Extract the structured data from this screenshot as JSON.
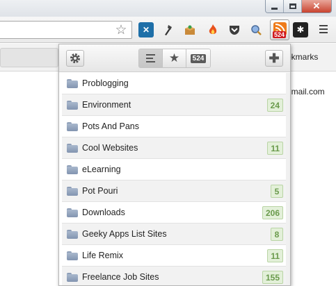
{
  "window": {
    "minimize_glyph": "min",
    "maximize_glyph": "max",
    "close_glyph": "✕"
  },
  "toolbar": {
    "bookmark_star": "☆",
    "extensions": [
      {
        "icon": "stack-icon",
        "glyph": "✕"
      },
      {
        "icon": "tool-icon",
        "glyph": "⚒"
      },
      {
        "icon": "box-icon",
        "glyph": "📦"
      },
      {
        "icon": "fire-icon",
        "glyph": "🔥"
      },
      {
        "icon": "pocket-icon",
        "glyph": "⛉"
      },
      {
        "icon": "search-icon",
        "glyph": "⚲"
      }
    ],
    "rss_badge": "524",
    "ext_dark_glyph": "✱"
  },
  "bookmarks_bar": {
    "right_label": "okmarks",
    "email_fragment": "gmail.com"
  },
  "popup": {
    "toolbar": {
      "settings_icon": "gear-icon",
      "list_tab_icon": "list-icon",
      "favorites_tab_glyph": "★",
      "count_tab": "524",
      "add_glyph": "✚"
    },
    "folders": [
      {
        "name": "Problogging",
        "count": ""
      },
      {
        "name": "Environment",
        "count": "24"
      },
      {
        "name": "Pots And Pans",
        "count": ""
      },
      {
        "name": "Cool Websites",
        "count": "11"
      },
      {
        "name": "eLearning",
        "count": ""
      },
      {
        "name": "Pot Pouri",
        "count": "5"
      },
      {
        "name": "Downloads",
        "count": "206"
      },
      {
        "name": "Geeky Apps List Sites",
        "count": "8"
      },
      {
        "name": "Life Remix",
        "count": "11"
      },
      {
        "name": "Freelance Job Sites",
        "count": "155"
      }
    ]
  },
  "colors": {
    "rss_orange": "#ef7b1a",
    "badge_red": "#d0171d",
    "count_green": "#6a9a4c",
    "close_red": "#c9432f"
  }
}
